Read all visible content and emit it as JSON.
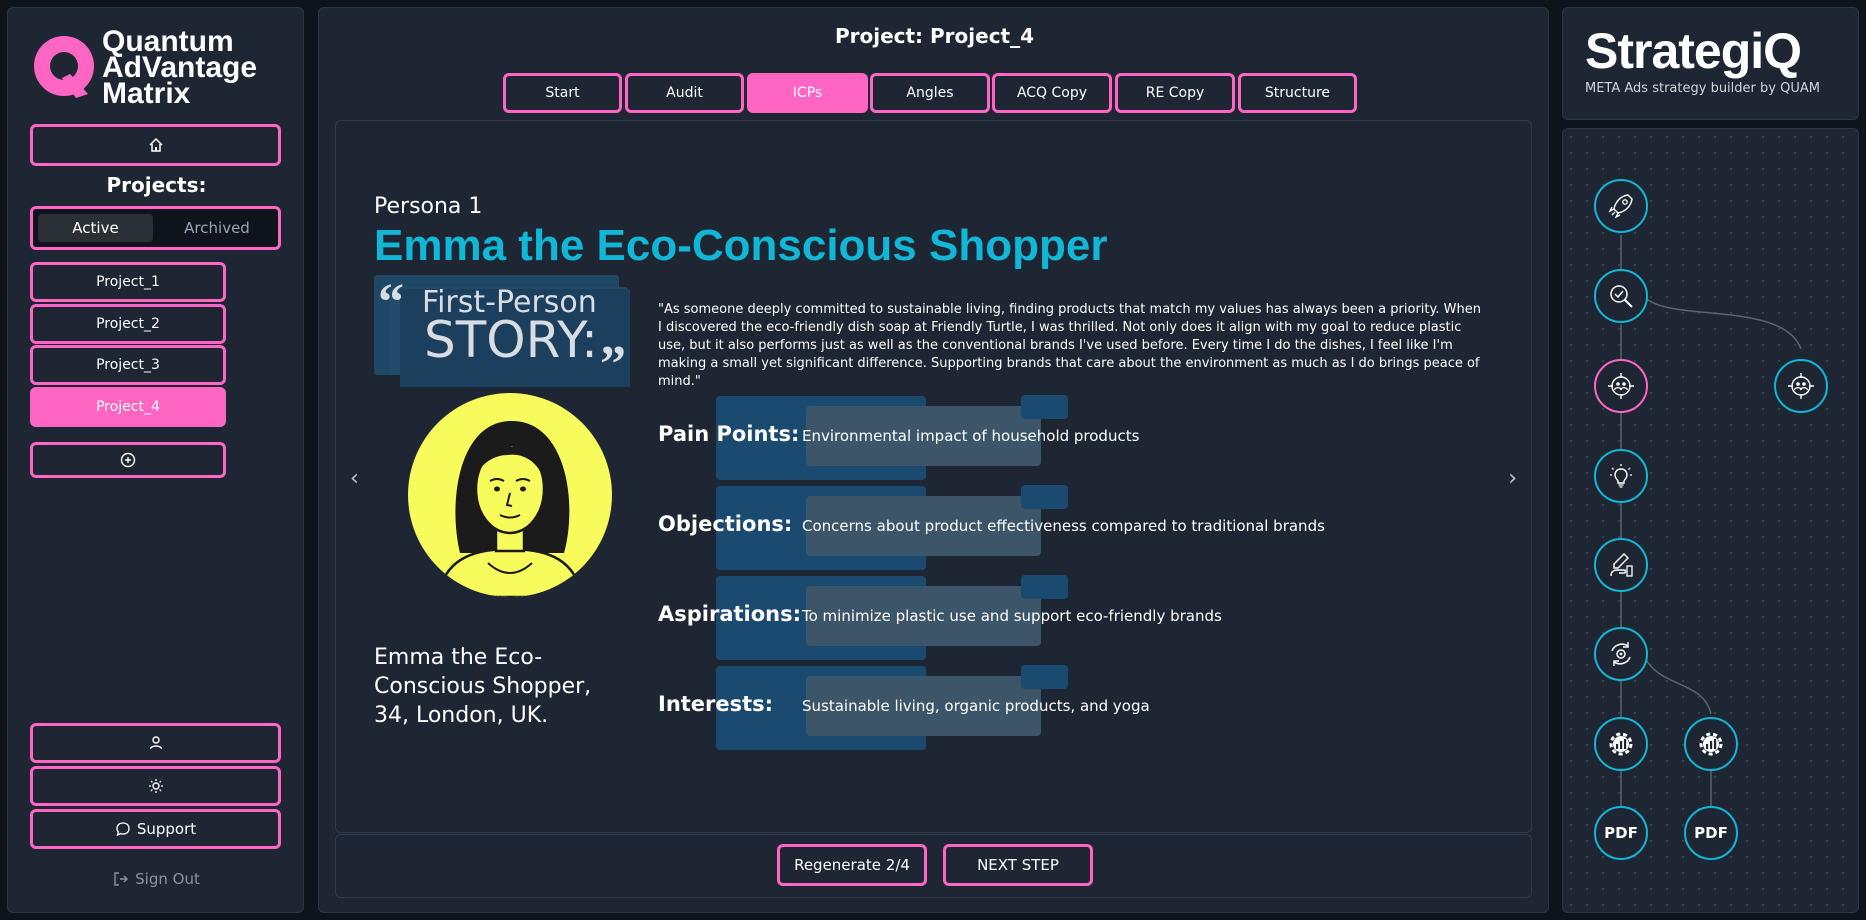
{
  "brand": {
    "line1": "Quantum",
    "line2": "AdVantage",
    "line3": "Matrix",
    "badge_letter": "Q"
  },
  "sidebar": {
    "projects_heading": "Projects:",
    "toggle": {
      "active": "Active",
      "archived": "Archived"
    },
    "projects": [
      "Project_1",
      "Project_2",
      "Project_3",
      "Project_4"
    ],
    "support_label": "Support",
    "signout_label": "Sign Out"
  },
  "header": {
    "title": "Project: Project_4"
  },
  "tabs": [
    "Start",
    "Audit",
    "ICPs",
    "Angles",
    "ACQ Copy",
    "RE Copy",
    "Structure"
  ],
  "persona": {
    "number": "Persona 1",
    "name": "Emma the Eco-Conscious Shopper",
    "story_badge_line1": "First-Person",
    "story_badge_line2": "STORY:",
    "quote": "\"As someone deeply committed to sustainable living, finding products that match my values has always been a priority. When I discovered the eco-friendly dish soap at Friendly Turtle, I was thrilled. Not only does it align with my goal to reduce plastic use, but it also performs just as well as the conventional brands I've used before. Every time I do the dishes, I feel like I'm making a small yet significant difference. Supporting brands that care about the environment as much as I do brings peace of mind.\"",
    "caption_line1": "Emma the Eco-",
    "caption_line2": "Conscious Shopper,",
    "caption_line3": "34, London, UK.",
    "attributes": [
      {
        "label": "Pain Points:",
        "value": "Environmental impact of household products"
      },
      {
        "label": "Objections:",
        "value": "Concerns about product effectiveness compared to traditional brands"
      },
      {
        "label": "Aspirations:",
        "value": "To minimize plastic use and support eco-friendly brands"
      },
      {
        "label": "Interests:",
        "value": "Sustainable living, organic products, and yoga"
      }
    ]
  },
  "footer": {
    "regenerate_label": "Regenerate 2/4",
    "next_label": "NEXT STEP"
  },
  "right": {
    "logo": "StrategiQ",
    "tagline": "META Ads strategy builder by QUAM",
    "pdf_label": "PDF",
    "flow_nodes": [
      "rocket-icon",
      "search-check-icon",
      "target-people-icon",
      "target-people-icon",
      "lightbulb-icon",
      "hand-write-icon",
      "cycle-gear-icon",
      "gear-chart-icon",
      "gear-chart-icon",
      "PDF",
      "PDF"
    ]
  },
  "colors": {
    "accent_pink": "#ff66c4",
    "accent_cyan": "#12b6d6",
    "panel_bg": "#1e2633",
    "avatar_yellow": "#f8fb5c"
  }
}
